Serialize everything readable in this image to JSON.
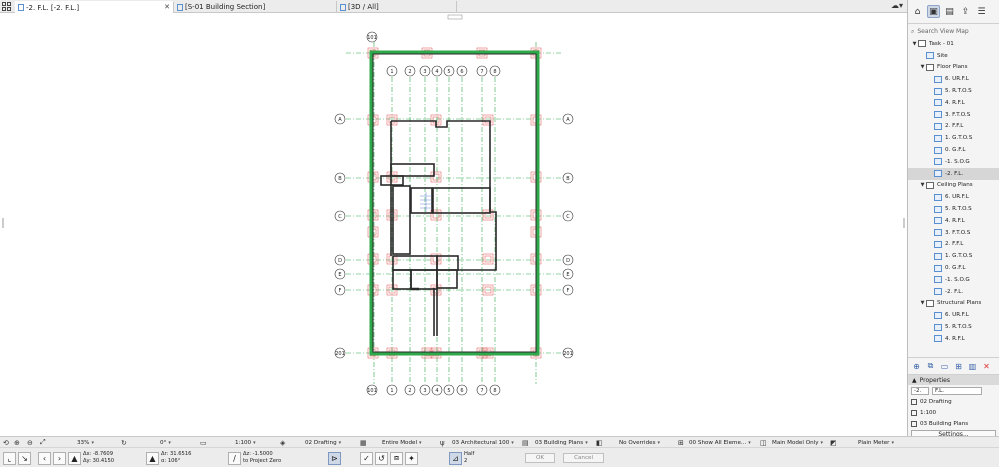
{
  "tabs": [
    {
      "label": "-2. F.L. [-2. F.L.]",
      "active": true
    },
    {
      "label": "[S-01 Building Section]",
      "active": false
    },
    {
      "label": "[3D / All]",
      "active": false
    }
  ],
  "drawing": {
    "top_bubble": "101",
    "column_grid_labels": [
      "1",
      "2",
      "3",
      "4",
      "5",
      "6",
      "7",
      "8"
    ],
    "row_grid_labels": [
      "A",
      "B",
      "C",
      "D",
      "E",
      "F"
    ],
    "bottom_left_bubble": "201",
    "bottom_right_bubble": "201",
    "bottom_extra_bubble": "101"
  },
  "navigator": {
    "search_placeholder": "Search View Map",
    "tree": [
      {
        "label": "Task - 01",
        "level": 0,
        "toggle": "▼",
        "type": "folder"
      },
      {
        "label": "Site",
        "level": 1,
        "toggle": "",
        "type": "view"
      },
      {
        "label": "Floor Plans",
        "level": 1,
        "toggle": "▼",
        "type": "folder"
      },
      {
        "label": "6. UR.F.L",
        "level": 2,
        "toggle": "",
        "type": "view"
      },
      {
        "label": "5. R.T.O.S",
        "level": 2,
        "toggle": "",
        "type": "view"
      },
      {
        "label": "4. R.F.L",
        "level": 2,
        "toggle": "",
        "type": "view"
      },
      {
        "label": "3. F.T.O.S",
        "level": 2,
        "toggle": "",
        "type": "view"
      },
      {
        "label": "2. F.F.L",
        "level": 2,
        "toggle": "",
        "type": "view"
      },
      {
        "label": "1. G.T.O.S",
        "level": 2,
        "toggle": "",
        "type": "view"
      },
      {
        "label": "0. G.F.L",
        "level": 2,
        "toggle": "",
        "type": "view"
      },
      {
        "label": "-1. S.O.G",
        "level": 2,
        "toggle": "",
        "type": "view"
      },
      {
        "label": "-2. F.L.",
        "level": 2,
        "toggle": "",
        "type": "view",
        "selected": true
      },
      {
        "label": "Ceiling Plans",
        "level": 1,
        "toggle": "▼",
        "type": "folder"
      },
      {
        "label": "6. UR.F.L",
        "level": 2,
        "toggle": "",
        "type": "view"
      },
      {
        "label": "5. R.T.O.S",
        "level": 2,
        "toggle": "",
        "type": "view"
      },
      {
        "label": "4. R.F.L",
        "level": 2,
        "toggle": "",
        "type": "view"
      },
      {
        "label": "3. F.T.O.S",
        "level": 2,
        "toggle": "",
        "type": "view"
      },
      {
        "label": "2. F.F.L",
        "level": 2,
        "toggle": "",
        "type": "view"
      },
      {
        "label": "1. G.T.O.S",
        "level": 2,
        "toggle": "",
        "type": "view"
      },
      {
        "label": "0. G.F.L",
        "level": 2,
        "toggle": "",
        "type": "view"
      },
      {
        "label": "-1. S.O.G",
        "level": 2,
        "toggle": "",
        "type": "view"
      },
      {
        "label": "-2. F.L.",
        "level": 2,
        "toggle": "",
        "type": "view"
      },
      {
        "label": "Structural Plans",
        "level": 1,
        "toggle": "▼",
        "type": "folder"
      },
      {
        "label": "6. UR.F.L",
        "level": 2,
        "toggle": "",
        "type": "view"
      },
      {
        "label": "5. R.T.O.S",
        "level": 2,
        "toggle": "",
        "type": "view"
      },
      {
        "label": "4. R.F.L",
        "level": 2,
        "toggle": "",
        "type": "view"
      }
    ]
  },
  "properties": {
    "header": "Properties",
    "id_value": "-2.",
    "name_value": "F.L.",
    "layer_combo": "02 Drafting",
    "scale": "1:100",
    "model_view": "03 Building Plans",
    "settings_label": "Settings..."
  },
  "statusbar": {
    "zoom": "33%",
    "angle": "0°",
    "scale": "1:100",
    "layer_combo": "02 Drafting",
    "model_filter": "Entire Model",
    "pen_set": "03 Architectural 100",
    "model_view_options": "03 Building Plans",
    "override": "No Overrides",
    "renovation": "00 Show All Eleme...",
    "structure": "Main Model Only",
    "markup": "Plain Meter"
  },
  "coords": {
    "dx": "Δx: -8.7609",
    "dy": "Δy: 30.4150",
    "dr": "Δr: 31.6516",
    "da": "α: 106°",
    "dz": "Δz: -1.5000",
    "dz_ref": "to Project Zero",
    "half_label": "Half",
    "half_value": "2",
    "ok_label": "OK",
    "cancel_label": "Cancel"
  },
  "colors": {
    "grid_green": "#2ea84a",
    "wall_dark": "#3a3a3a",
    "column_red": "#e24b4b",
    "accent_blue": "#3a63a8"
  }
}
